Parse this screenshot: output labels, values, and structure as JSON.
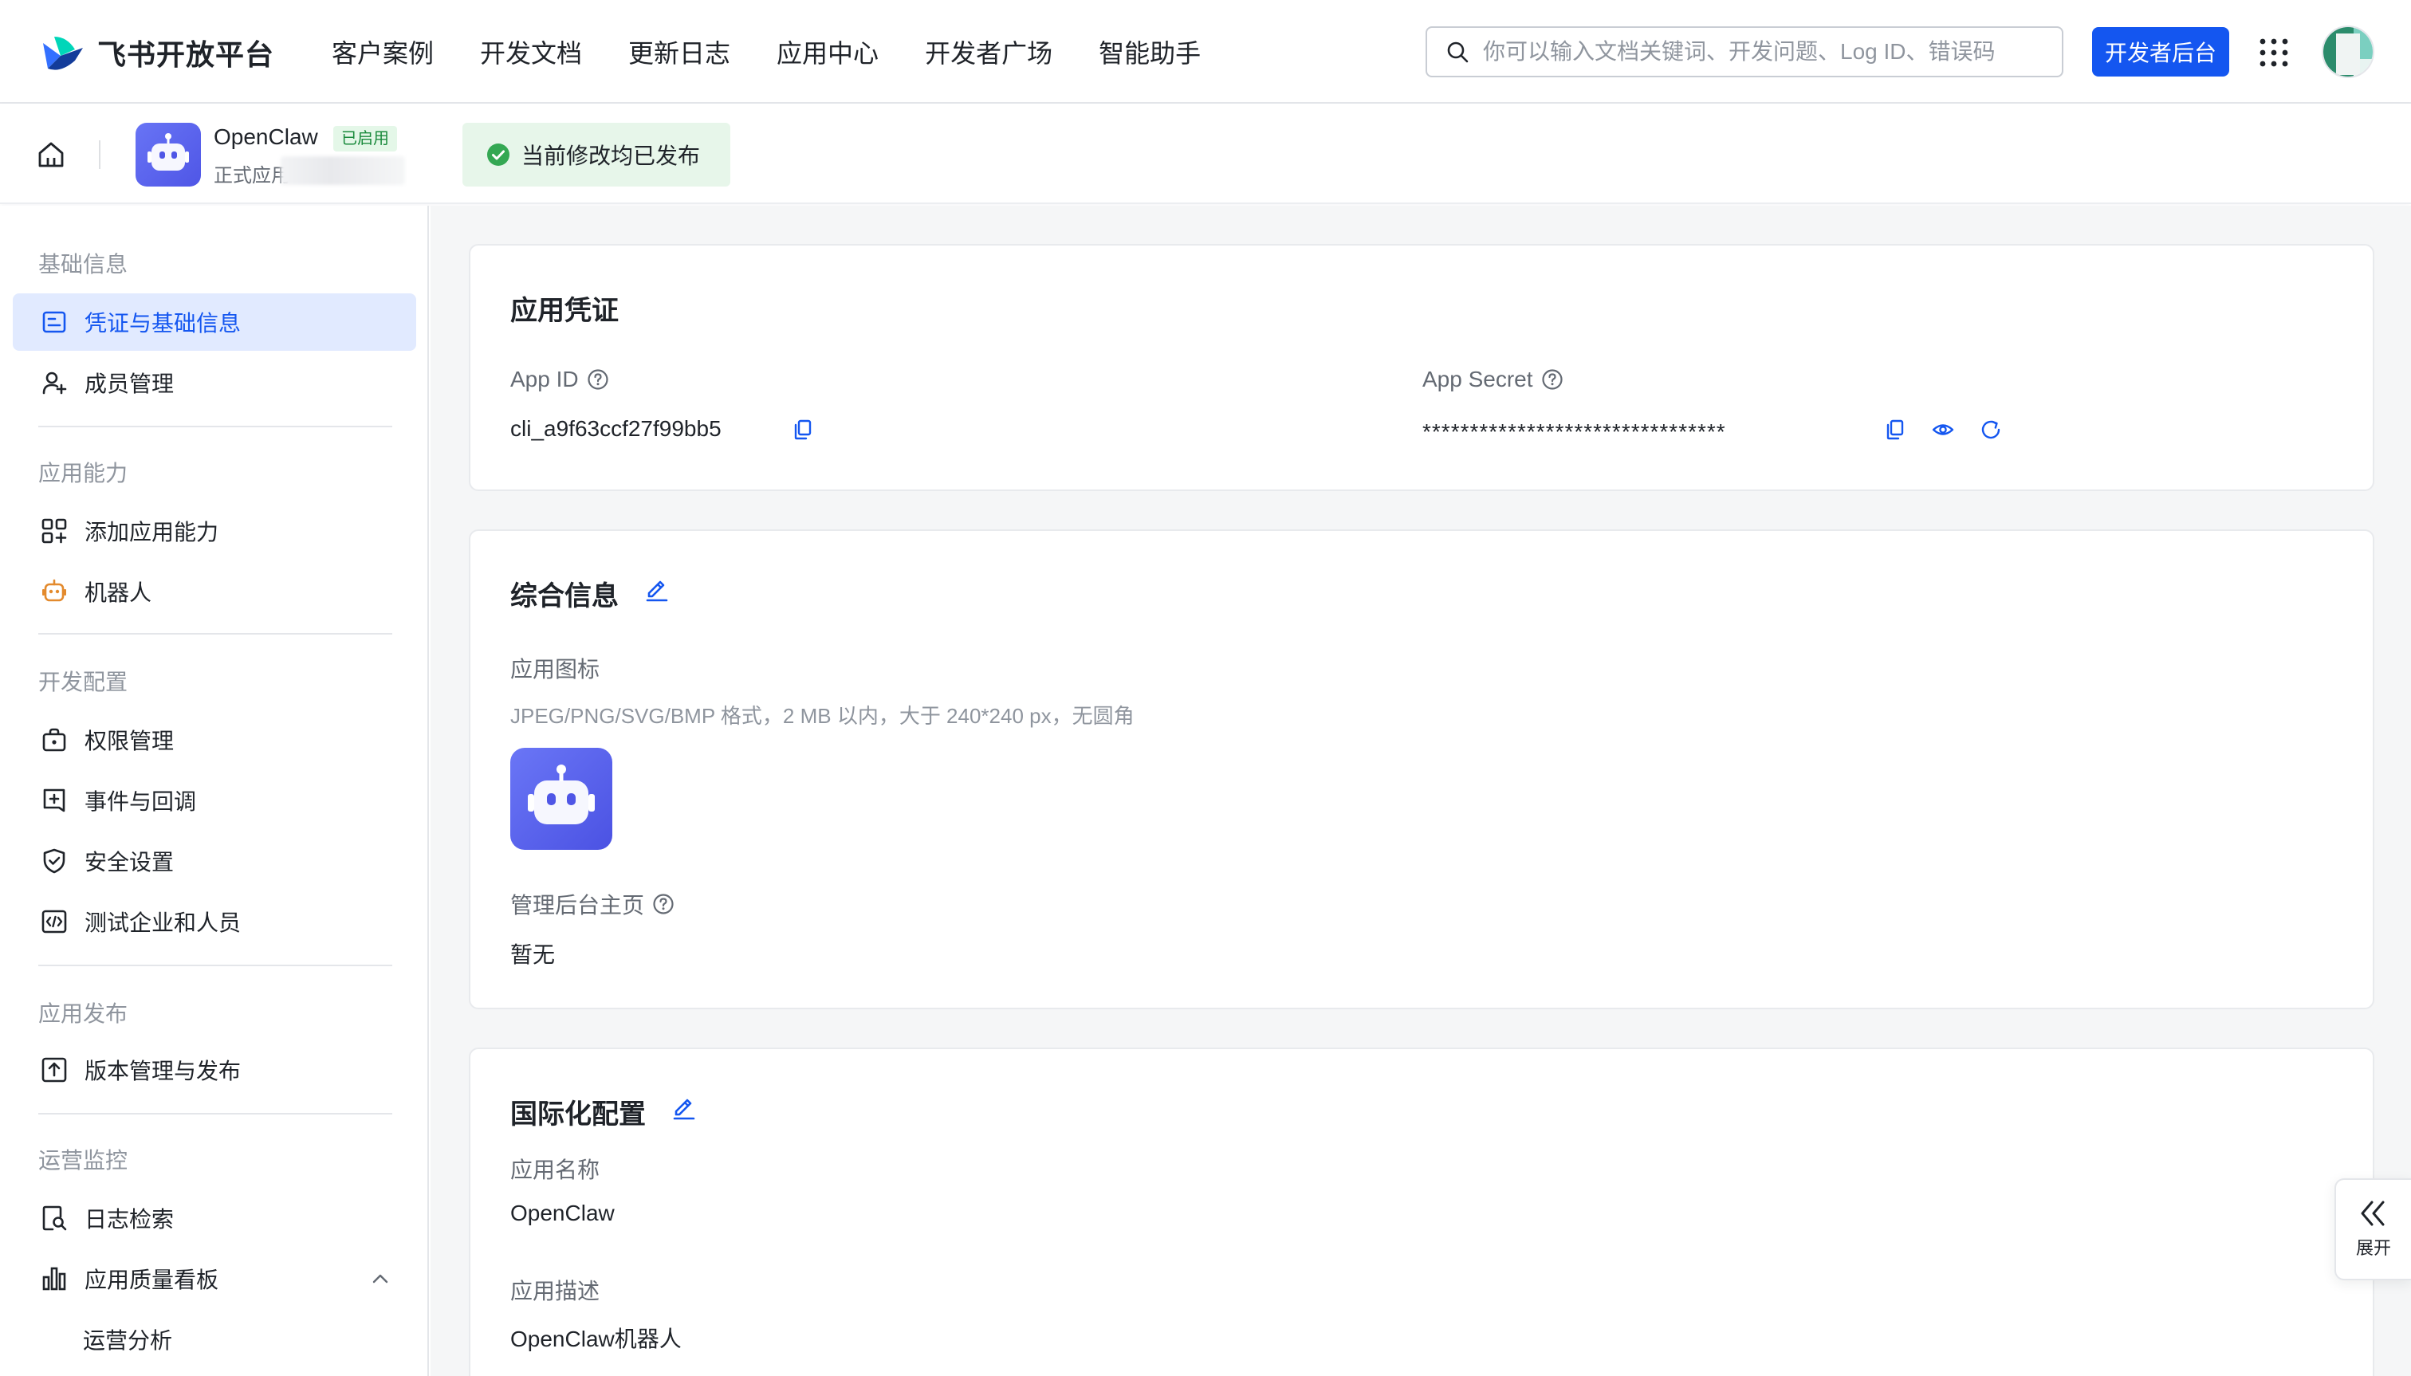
{
  "topnav": {
    "logo_text": "飞书开放平台",
    "nav_items": [
      "客户案例",
      "开发文档",
      "更新日志",
      "应用中心",
      "开发者广场",
      "智能助手"
    ],
    "search_placeholder": "你可以输入文档关键词、开发问题、Log ID、错误码",
    "dev_console_label": "开发者后台"
  },
  "subheader": {
    "app_name": "OpenClaw",
    "app_status_badge": "已启用",
    "app_sub_label": "正式应用",
    "publish_status": "当前修改均已发布"
  },
  "sidebar": {
    "groups": [
      {
        "title": "基础信息",
        "items": [
          {
            "label": "凭证与基础信息",
            "icon": "credential-icon",
            "active": true
          },
          {
            "label": "成员管理",
            "icon": "member-icon"
          }
        ]
      },
      {
        "title": "应用能力",
        "items": [
          {
            "label": "添加应用能力",
            "icon": "add-capability-icon"
          },
          {
            "label": "机器人",
            "icon": "robot-icon"
          }
        ]
      },
      {
        "title": "开发配置",
        "items": [
          {
            "label": "权限管理",
            "icon": "permission-icon"
          },
          {
            "label": "事件与回调",
            "icon": "event-icon"
          },
          {
            "label": "安全设置",
            "icon": "shield-icon"
          },
          {
            "label": "测试企业和人员",
            "icon": "code-icon"
          }
        ]
      },
      {
        "title": "应用发布",
        "items": [
          {
            "label": "版本管理与发布",
            "icon": "upload-icon"
          }
        ]
      },
      {
        "title": "运营监控",
        "items": [
          {
            "label": "日志检索",
            "icon": "log-search-icon"
          },
          {
            "label": "应用质量看板",
            "icon": "bar-chart-icon"
          },
          {
            "label": "运营分析",
            "icon": ""
          }
        ]
      }
    ]
  },
  "credentials": {
    "title": "应用凭证",
    "app_id_label": "App ID",
    "app_id_value": "cli_a9f63ccf27f99bb5",
    "app_secret_label": "App Secret",
    "app_secret_value": "********************************"
  },
  "general_info": {
    "title": "综合信息",
    "icon_label": "应用图标",
    "icon_hint": "JPEG/PNG/SVG/BMP 格式，2 MB 以内，大于 240*240 px，无圆角",
    "admin_home_label": "管理后台主页",
    "admin_home_value": "暂无"
  },
  "i18n": {
    "title": "国际化配置",
    "name_label": "应用名称",
    "name_value": "OpenClaw",
    "desc_label": "应用描述",
    "desc_value": "OpenClaw机器人"
  },
  "expand_label": "展开",
  "colors": {
    "primary": "#1456f0",
    "success": "#34a853",
    "active_bg": "#e1eaff",
    "app_icon": "#5b63ee"
  }
}
